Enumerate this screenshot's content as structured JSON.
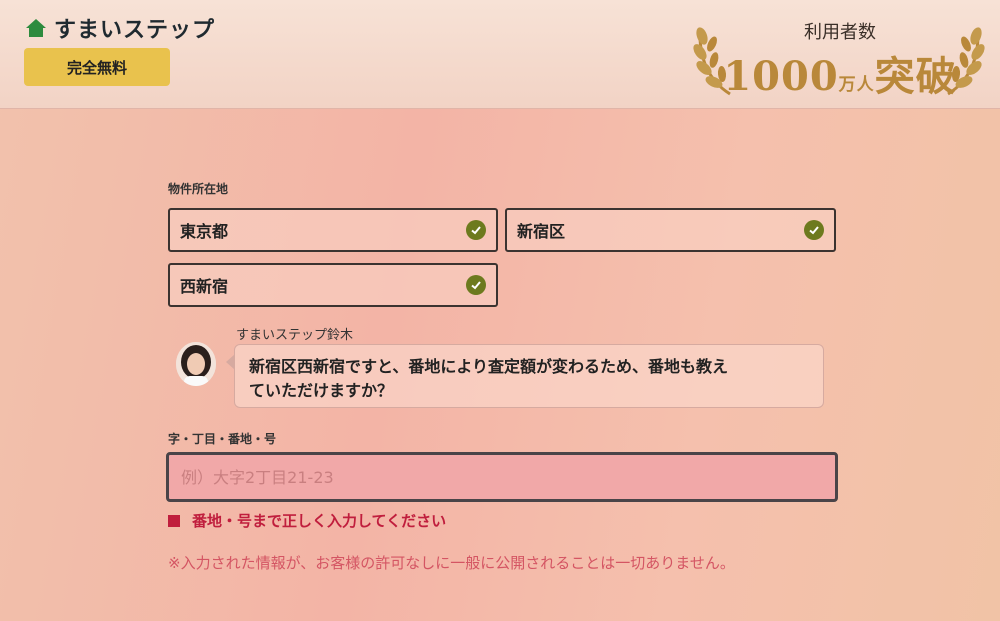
{
  "header": {
    "logo_text": "すまいステップ",
    "free_badge": "完全無料",
    "users_label": "利用者数",
    "users_count": "1000",
    "users_unit_top": "万",
    "users_unit_bottom": "人",
    "users_suffix": "突破"
  },
  "form": {
    "location_label": "物件所在地",
    "prefecture": "東京都",
    "city": "新宿区",
    "town": "西新宿",
    "agent_name": "すまいステップ鈴木",
    "agent_message_line1": "新宿区西新宿ですと、番地により査定額が変わるため、番地も教え",
    "agent_message_line2": "ていただけますか？",
    "address_label": "字・丁目・番地・号",
    "address_value": "",
    "address_placeholder": "例）大字2丁目21-23",
    "error_message": "番地・号まで正しく入力してください",
    "privacy_note": "※入力された情報が、お客様の許可なしに一般に公開されることは一切ありません。"
  },
  "colors": {
    "accent_gold": "#e9c24d",
    "check_green": "#6d7a1e",
    "error_red": "#c01e3d"
  },
  "icons": {
    "logo": "house-icon",
    "check": "check-circle-icon",
    "laurel": "laurel-wreath-icon"
  }
}
